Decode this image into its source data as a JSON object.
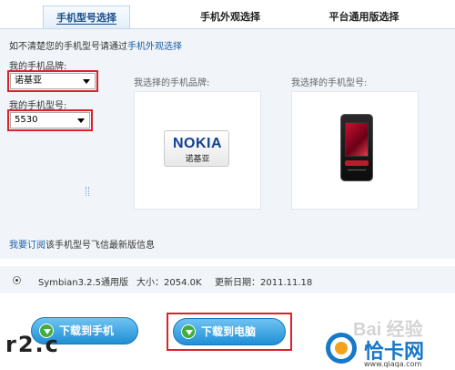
{
  "tabs": [
    {
      "label": "手机型号选择",
      "active": true
    },
    {
      "label": "手机外观选择",
      "active": false
    },
    {
      "label": "平台通用版选择",
      "active": false
    }
  ],
  "hint": {
    "prefix": "如不清楚您的手机型号请通过",
    "link": "手机外观选择"
  },
  "brand": {
    "label": "我的手机品牌:",
    "value": "诺基亚"
  },
  "model": {
    "label": "我的手机型号:",
    "value": "5530"
  },
  "selected_brand_title": "我选择的手机品牌:",
  "selected_model_title": "我选择的手机型号:",
  "brand_logo": {
    "name": "NOKIA",
    "sub": "诺基亚"
  },
  "subscribe": {
    "link": "我要订阅",
    "text": "该手机型号飞信最新版信息"
  },
  "package": {
    "version": "Symbian3.2.5通用版",
    "size": "大小：2054.0K",
    "updated": "更新日期：2011.11.18"
  },
  "buttons": {
    "download_phone": "下载到手机",
    "download_pc": "下载到电脑"
  },
  "watermarks": {
    "left": "r2.c",
    "baidu": "Bai 经验",
    "site": "恰卡网",
    "url": "www.qiaqa.com"
  },
  "colors": {
    "accent_blue": "#1d5fa5",
    "highlight_red": "#d8232a",
    "button_blue": "#1f8fd6"
  }
}
